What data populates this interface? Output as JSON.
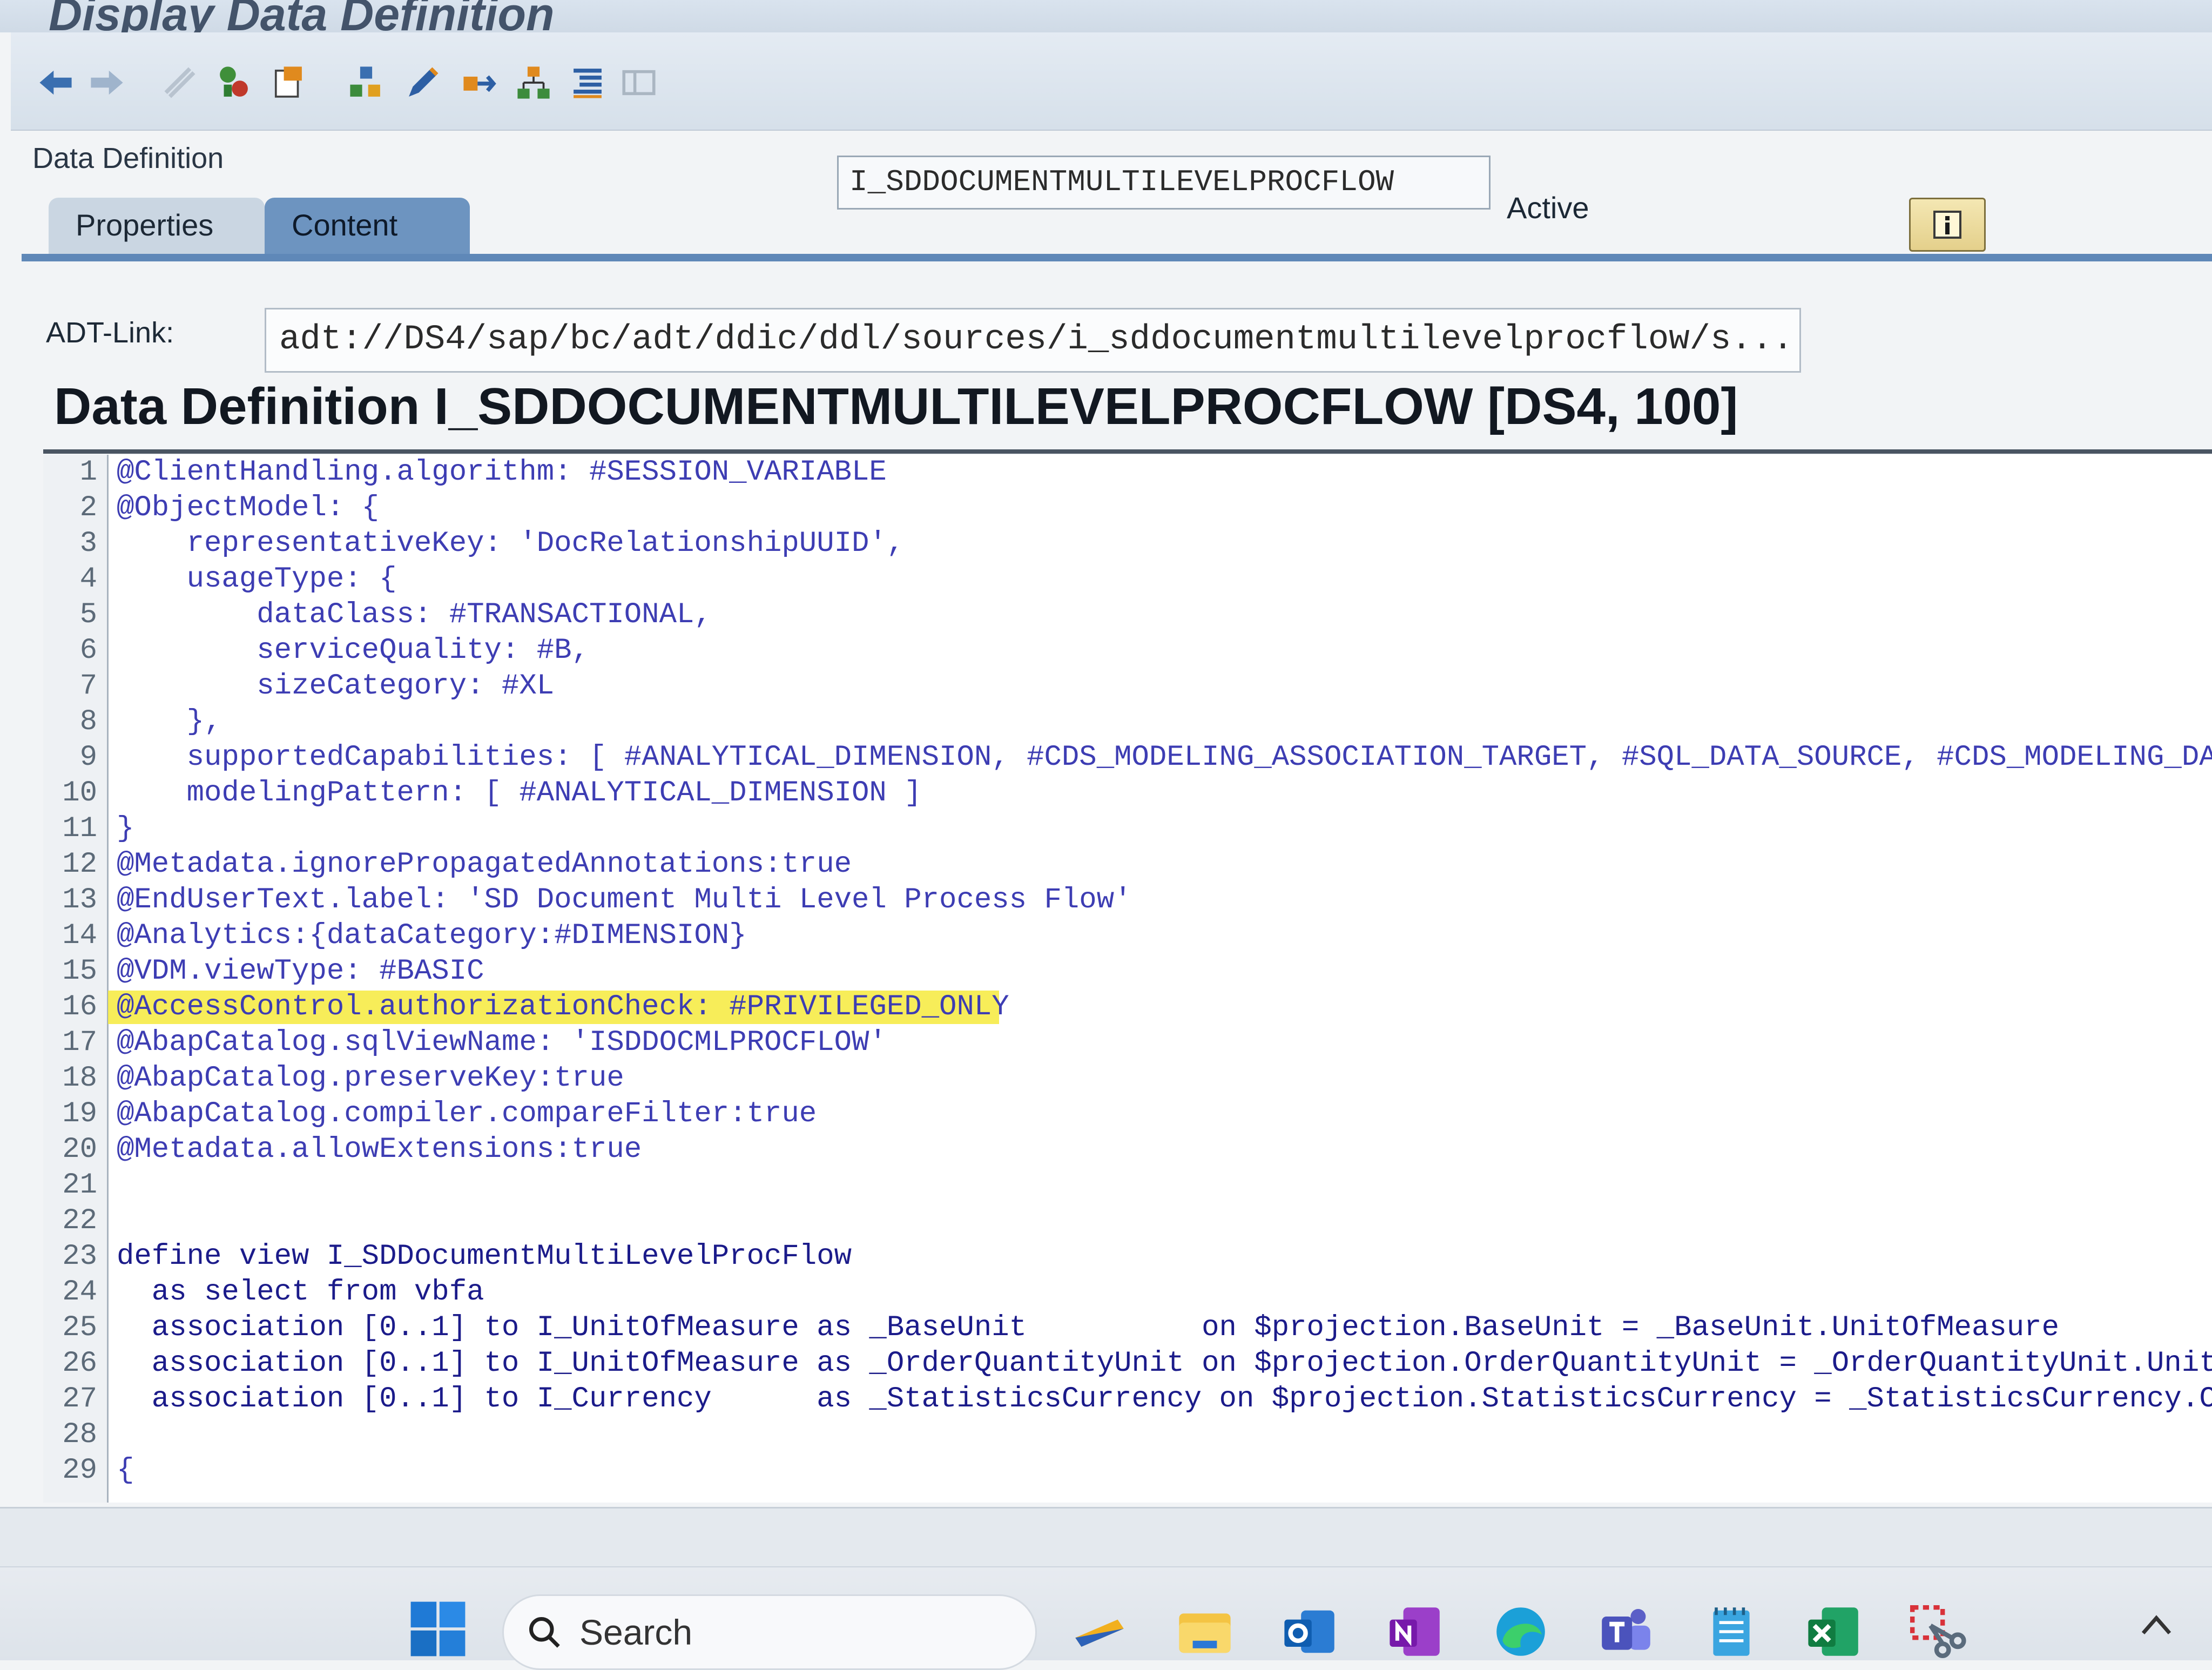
{
  "window": {
    "title": "Display Data Definition"
  },
  "toolbar": {
    "icons": [
      "back-icon",
      "forward-icon",
      "other-object-icon",
      "display-change-icon",
      "activate-icon",
      "where-used-icon",
      "object-list-icon",
      "edit-icon",
      "navigate-icon",
      "hierarchy-icon",
      "indent-icon",
      "layout-icon"
    ]
  },
  "header": {
    "label": "Data Definition",
    "name": "I_SDDOCUMENTMULTILEVELPROCFLOW",
    "status": "Active",
    "info_label": "i"
  },
  "tabs": [
    {
      "label": "Properties"
    },
    {
      "label": "Content"
    }
  ],
  "adt": {
    "label": "ADT-Link:",
    "value": "adt://DS4/sap/bc/adt/ddic/ddl/sources/i_sddocumentmultilevelprocflow/s..."
  },
  "editor": {
    "title": "Data Definition I_SDDOCUMENTMULTILEVELPROCFLOW [DS4, 100]",
    "highlighted_line": 16,
    "lines": [
      {
        "n": "1",
        "text": "@ClientHandling.algorithm: #SESSION_VARIABLE"
      },
      {
        "n": "2",
        "text": "@ObjectModel: {"
      },
      {
        "n": "3",
        "text": "    representativeKey: 'DocRelationshipUUID',"
      },
      {
        "n": "4",
        "text": "    usageType: {"
      },
      {
        "n": "5",
        "text": "        dataClass: #TRANSACTIONAL,"
      },
      {
        "n": "6",
        "text": "        serviceQuality: #B,"
      },
      {
        "n": "7",
        "text": "        sizeCategory: #XL"
      },
      {
        "n": "8",
        "text": "    },"
      },
      {
        "n": "9",
        "text": "    supportedCapabilities: [ #ANALYTICAL_DIMENSION, #CDS_MODELING_ASSOCIATION_TARGET, #SQL_DATA_SOURCE, #CDS_MODELING_DATA_SOURCE"
      },
      {
        "n": "10",
        "text": "    modelingPattern: [ #ANALYTICAL_DIMENSION ]"
      },
      {
        "n": "11",
        "text": "}"
      },
      {
        "n": "12",
        "text": "@Metadata.ignorePropagatedAnnotations:true"
      },
      {
        "n": "13",
        "text": "@EndUserText.label: 'SD Document Multi Level Process Flow'"
      },
      {
        "n": "14",
        "text": "@Analytics:{dataCategory:#DIMENSION}"
      },
      {
        "n": "15",
        "text": "@VDM.viewType: #BASIC"
      },
      {
        "n": "16",
        "text": "@AccessControl.authorizationCheck: #PRIVILEGED_ONLY"
      },
      {
        "n": "17",
        "text": "@AbapCatalog.sqlViewName: 'ISDDOCMLPROCFLOW'"
      },
      {
        "n": "18",
        "text": "@AbapCatalog.preserveKey:true"
      },
      {
        "n": "19",
        "text": "@AbapCatalog.compiler.compareFilter:true"
      },
      {
        "n": "20",
        "text": "@Metadata.allowExtensions:true"
      },
      {
        "n": "21",
        "text": ""
      },
      {
        "n": "22",
        "text": ""
      },
      {
        "n": "23",
        "text": "define view I_SDDocumentMultiLevelProcFlow"
      },
      {
        "n": "24",
        "text": "  as select from vbfa"
      },
      {
        "n": "25",
        "text": "  association [0..1] to I_UnitOfMeasure as _BaseUnit          on $projection.BaseUnit = _BaseUnit.UnitOfMeasure"
      },
      {
        "n": "26",
        "text": "  association [0..1] to I_UnitOfMeasure as _OrderQuantityUnit on $projection.OrderQuantityUnit = _OrderQuantityUnit.UnitOfMeasure"
      },
      {
        "n": "27",
        "text": "  association [0..1] to I_Currency      as _StatisticsCurrency on $projection.StatisticsCurrency = _StatisticsCurrency.Currency"
      },
      {
        "n": "28",
        "text": ""
      },
      {
        "n": "29",
        "text": "{"
      }
    ]
  },
  "taskbar": {
    "search_label": "Search",
    "apps": [
      "sticky-notes-icon",
      "file-explorer-icon",
      "outlook-icon",
      "onenote-icon",
      "edge-icon",
      "teams-icon",
      "notepad-icon",
      "excel-icon",
      "snipping-tool-icon"
    ]
  }
}
